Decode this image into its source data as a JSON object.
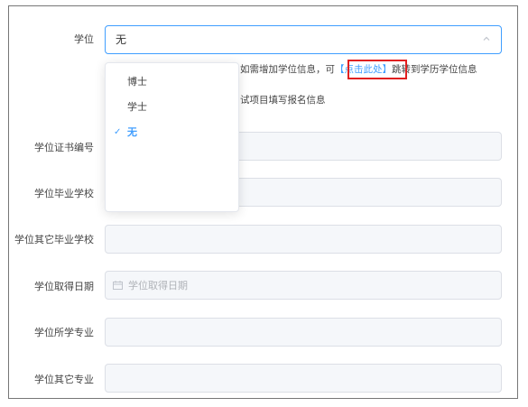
{
  "form": {
    "degree": {
      "label": "学位",
      "value": "无",
      "options": [
        {
          "label": "博士",
          "selected": false
        },
        {
          "label": "学士",
          "selected": false
        },
        {
          "label": "无",
          "selected": true
        }
      ]
    },
    "hint": {
      "line1_prefix": "如需增加学位信息，可",
      "link_text": "【点击此处】",
      "line1_suffix": "跳转到学历学位信息",
      "line2": "试项目填写报名信息"
    },
    "certificate_no": {
      "label": "学位证书编号"
    },
    "school": {
      "label": "学位毕业学校"
    },
    "other_school": {
      "label": "学位其它毕业学校"
    },
    "date": {
      "label": "学位取得日期",
      "placeholder": "学位取得日期"
    },
    "major": {
      "label": "学位所学专业"
    },
    "other_major": {
      "label": "学位其它专业"
    }
  },
  "colors": {
    "accent": "#409eff",
    "highlight": "#e02020",
    "field_bg": "#f5f7fa"
  },
  "icons": {
    "select_arrow": "chevron-up-icon",
    "date": "calendar-icon",
    "selected_option": "check-icon"
  }
}
